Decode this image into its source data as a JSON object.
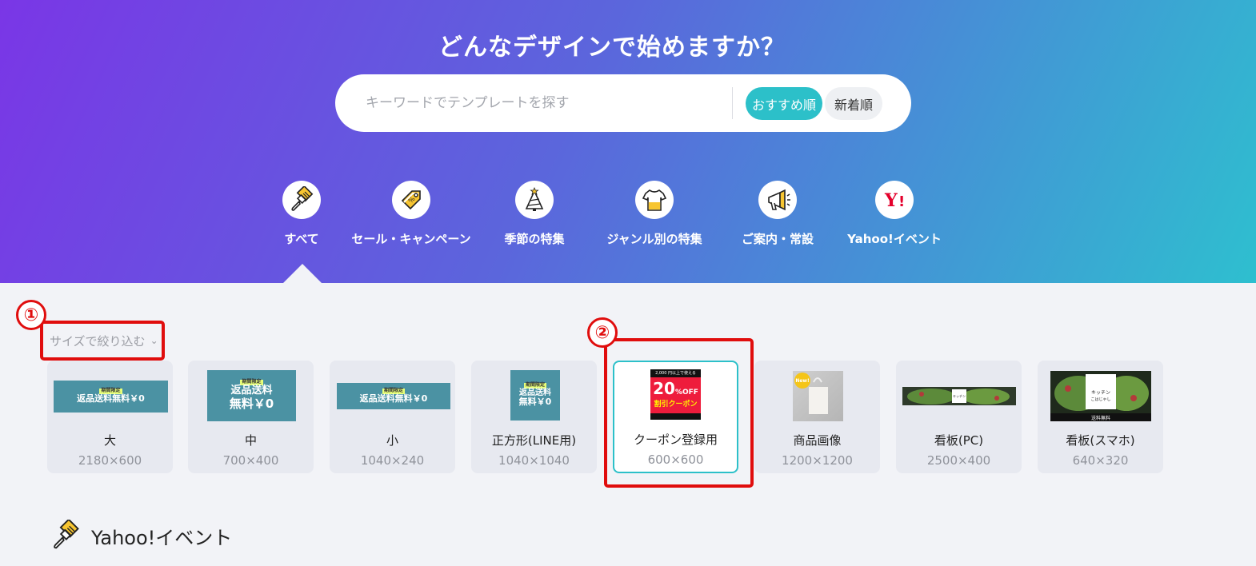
{
  "hero": {
    "title": "どんなデザインで始めますか？",
    "search_placeholder": "キーワードでテンプレートを探す",
    "sort_recommend": "おすすめ順",
    "sort_new": "新着順"
  },
  "categories": [
    {
      "label": "すべて",
      "icon": "paintbrush-icon"
    },
    {
      "label": "セール・キャンペーン",
      "icon": "price-tag-icon"
    },
    {
      "label": "季節の特集",
      "icon": "christmas-tree-icon"
    },
    {
      "label": "ジャンル別の特集",
      "icon": "tshirt-icon"
    },
    {
      "label": "ご案内・常設",
      "icon": "megaphone-icon"
    },
    {
      "label": "Yahoo!イベント",
      "icon": "yahoo-logo-icon"
    }
  ],
  "filter": {
    "size_label": "サイズで絞り込む"
  },
  "annotations": [
    "①",
    "②"
  ],
  "sizes": [
    {
      "name": "大",
      "dim": "2180×600"
    },
    {
      "name": "中",
      "dim": "700×400"
    },
    {
      "name": "小",
      "dim": "1040×240"
    },
    {
      "name": "正方形(LINE用)",
      "dim": "1040×1040"
    },
    {
      "name": "クーポン登録用",
      "dim": "600×600",
      "selected": true
    },
    {
      "name": "商品画像",
      "dim": "1200×1200"
    },
    {
      "name": "看板(PC)",
      "dim": "2500×400"
    },
    {
      "name": "看板(スマホ)",
      "dim": "640×320"
    }
  ],
  "thumbs": {
    "large": {
      "tag": "期間限定",
      "text": "返品送料無料￥0"
    },
    "medium": {
      "tag": "期間限定",
      "line1": "返品送料",
      "line2": "無料￥0"
    },
    "small": {
      "tag": "期間限定",
      "text": "返品送料無料￥0"
    },
    "square": {
      "tag": "期間限定",
      "line1": "返品送料",
      "line2": "無料￥0"
    },
    "coupon": {
      "top": "2,000 円以上で使える",
      "big": "20",
      "off": "%OFF",
      "label": "割引クーポン"
    },
    "product": {
      "badge": "New!"
    },
    "sign_pc": {
      "text": "キッチン"
    },
    "sign_sp": {
      "line1": "キッチン",
      "line2": "こはじゃし",
      "footer": "送料無料"
    }
  },
  "section": {
    "title": "Yahoo!イベント",
    "icon": "paintbrush-icon"
  },
  "colors": {
    "accent": "#2cc0c9",
    "annotation": "#e00d0d",
    "hero_start": "#7a36e6",
    "hero_end": "#2ebfcf"
  }
}
